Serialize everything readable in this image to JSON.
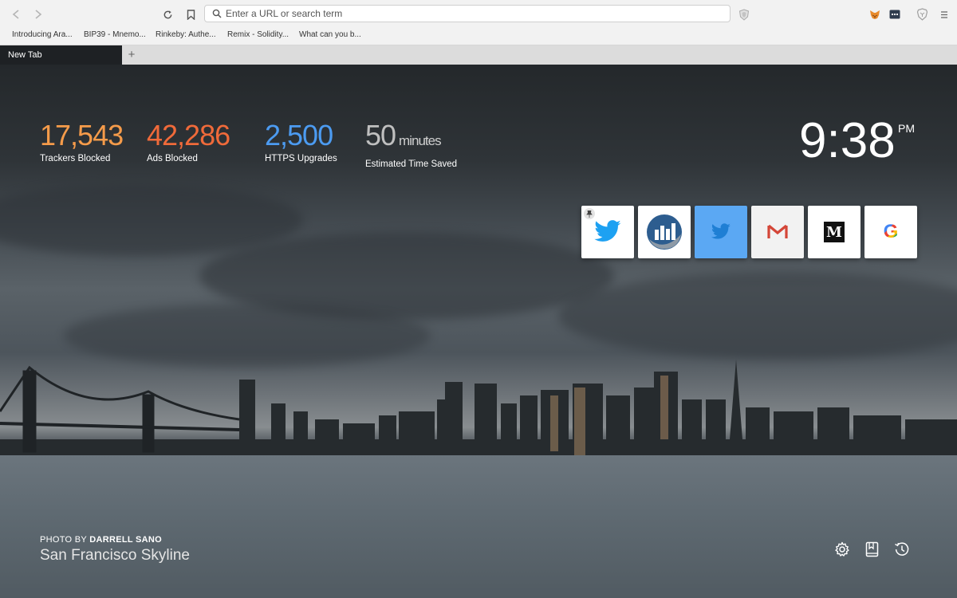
{
  "urlbar": {
    "placeholder": "Enter a URL or search term"
  },
  "bookmarks": [
    "Introducing Ara...",
    "BIP39 - Mnemo...",
    "Rinkeby: Authe...",
    "Remix - Solidity...",
    "What can you b..."
  ],
  "tabs": [
    {
      "label": "New Tab",
      "active": true
    }
  ],
  "new_tab_label": "+",
  "stats": [
    {
      "value": "17,543",
      "label": "Trackers Blocked",
      "color": "#f59b4a"
    },
    {
      "value": "42,286",
      "label": "Ads Blocked",
      "color": "#f06a3a"
    },
    {
      "value": "2,500",
      "label": "HTTPS Upgrades",
      "color": "#4c9bf1"
    },
    {
      "value": "50",
      "unit": "minutes",
      "label": "Estimated Time Saved",
      "color": "#bfbfbf"
    }
  ],
  "clock": {
    "time": "9:38",
    "ampm": "PM"
  },
  "top_sites": [
    {
      "icon": "twitter-icon",
      "pinned": true
    },
    {
      "icon": "site-logo-icon",
      "pinned": false
    },
    {
      "icon": "twitter-icon",
      "pinned": false
    },
    {
      "icon": "gmail-icon",
      "pinned": false
    },
    {
      "icon": "medium-icon",
      "text": "M",
      "pinned": false
    },
    {
      "icon": "google-icon",
      "text": "G",
      "pinned": false
    }
  ],
  "photo": {
    "prefix": "PHOTO BY",
    "author": "DARRELL SANO",
    "title": "San Francisco Skyline"
  },
  "colors": {
    "toolbar": "#f2f2f2",
    "twitter": "#1da1f2",
    "tile_active": "#5ba8f3"
  }
}
